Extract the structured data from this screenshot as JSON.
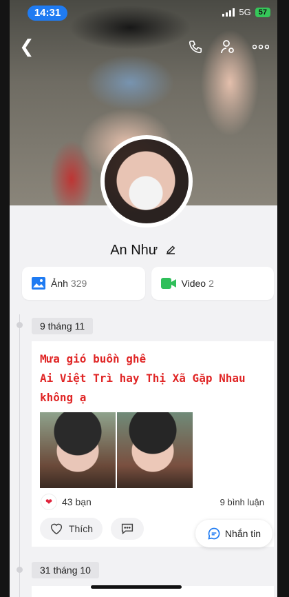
{
  "status_bar": {
    "time": "14:31",
    "network": "5G",
    "battery": "57"
  },
  "profile": {
    "name": "An Như"
  },
  "media_cards": [
    {
      "label": "Ảnh",
      "count": "329",
      "icon": "image-icon"
    },
    {
      "label": "Video",
      "count": "2",
      "icon": "video-icon"
    }
  ],
  "posts": [
    {
      "date": "9 tháng 11",
      "text_lines": [
        "Mưa gió buồn ghê",
        "Ai Việt Trì hay Thị Xã Gặp Nhau",
        "không ạ"
      ],
      "reactions": "43 bạn",
      "comments": "9 bình luận",
      "like_label": "Thích"
    }
  ],
  "next_date": "31 tháng 10",
  "message_button": "Nhắn tin",
  "colors": {
    "accent_blue": "#1f7bf2",
    "post_text_red": "#e02626",
    "video_green": "#2fbf5a"
  }
}
